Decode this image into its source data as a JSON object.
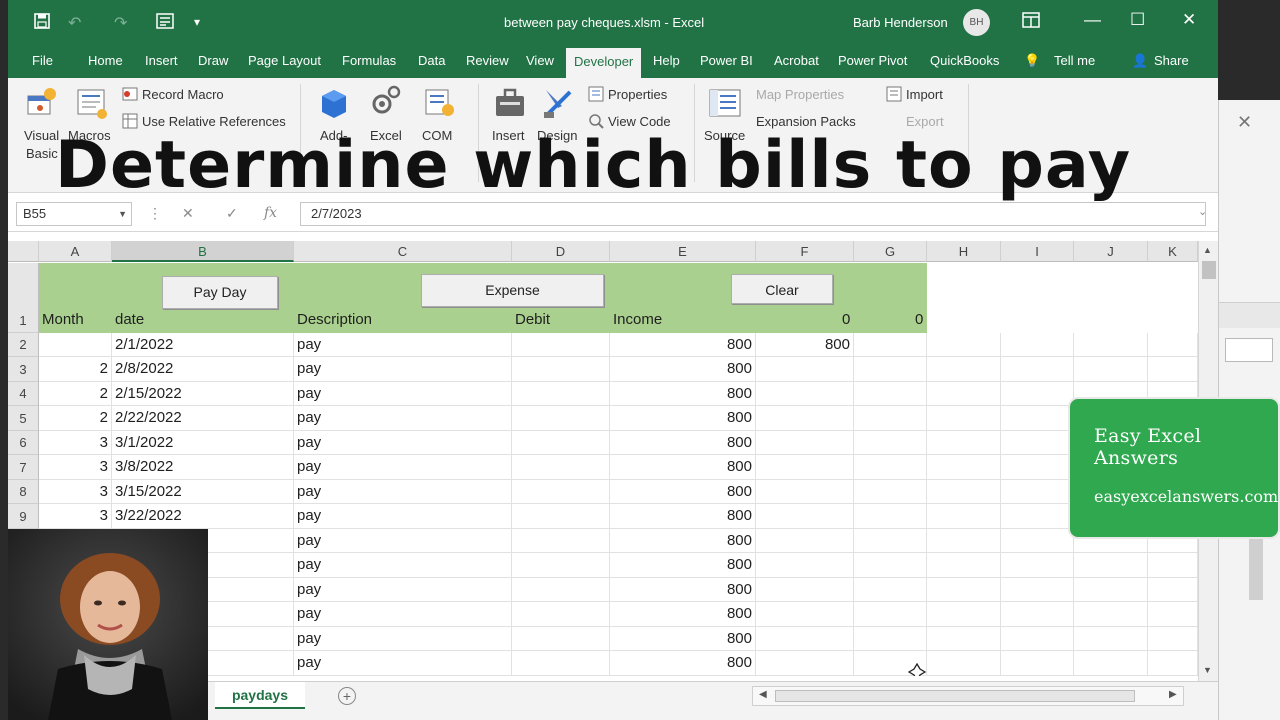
{
  "window": {
    "doc_title": "between pay cheques.xlsm - Excel",
    "user_name": "Barb Henderson",
    "user_initials": "BH"
  },
  "tabs": [
    {
      "label": "File"
    },
    {
      "label": "Home"
    },
    {
      "label": "Insert"
    },
    {
      "label": "Draw"
    },
    {
      "label": "Page Layout"
    },
    {
      "label": "Formulas"
    },
    {
      "label": "Data"
    },
    {
      "label": "Review"
    },
    {
      "label": "View"
    },
    {
      "label": "Developer",
      "active": true
    },
    {
      "label": "Help"
    },
    {
      "label": "Power BI"
    },
    {
      "label": "Acrobat"
    },
    {
      "label": "Power Pivot"
    },
    {
      "label": "QuickBooks"
    }
  ],
  "tell_me": "Tell me",
  "share": "Share",
  "ribbon": {
    "visual_basic": "Visual",
    "visual_basic_2": "Basic",
    "macros": "Macros",
    "record_macro": "Record Macro",
    "relative_refs": "Use Relative References",
    "addins": "Add-",
    "excel_addins": "Excel",
    "com_addins": "COM",
    "insert": "Insert",
    "design_mode": "Design",
    "properties": "Properties",
    "view_code": "View Code",
    "source": "Source",
    "map_properties": "Map Properties",
    "expansion_packs": "Expansion Packs",
    "import": "Import",
    "export": "Export"
  },
  "overlay_title": "Determine which bills to pay",
  "formula_bar": {
    "name_box": "B55",
    "formula": "2/7/2023"
  },
  "columns": [
    "A",
    "B",
    "C",
    "D",
    "E",
    "F",
    "G",
    "H",
    "I",
    "J",
    "K"
  ],
  "selected_column": "B",
  "buttons": {
    "pay_day": "Pay Day",
    "expense": "Expense",
    "clear": "Clear"
  },
  "header_row": {
    "row_num": "1",
    "month": "Month",
    "date": "date",
    "description": "Description",
    "debit": "Debit",
    "income": "Income",
    "f": "0",
    "g": "0"
  },
  "rows": [
    {
      "num": "2",
      "month": "",
      "date": "2/1/2022",
      "desc": "pay",
      "income": "800",
      "f": "800"
    },
    {
      "num": "3",
      "month": "2",
      "date": "2/8/2022",
      "desc": "pay",
      "income": "800",
      "f": ""
    },
    {
      "num": "4",
      "month": "2",
      "date": "2/15/2022",
      "desc": "pay",
      "income": "800",
      "f": ""
    },
    {
      "num": "5",
      "month": "2",
      "date": "2/22/2022",
      "desc": "pay",
      "income": "800",
      "f": ""
    },
    {
      "num": "6",
      "month": "3",
      "date": "3/1/2022",
      "desc": "pay",
      "income": "800",
      "f": ""
    },
    {
      "num": "7",
      "month": "3",
      "date": "3/8/2022",
      "desc": "pay",
      "income": "800",
      "f": ""
    },
    {
      "num": "8",
      "month": "3",
      "date": "3/15/2022",
      "desc": "pay",
      "income": "800",
      "f": ""
    },
    {
      "num": "9",
      "month": "3",
      "date": "3/22/2022",
      "desc": "pay",
      "income": "800",
      "f": ""
    },
    {
      "num": "",
      "month": "",
      "date": "",
      "desc": "pay",
      "income": "800",
      "f": ""
    },
    {
      "num": "",
      "month": "",
      "date": "",
      "desc": "pay",
      "income": "800",
      "f": ""
    },
    {
      "num": "",
      "month": "",
      "date": "",
      "desc": "pay",
      "income": "800",
      "f": ""
    },
    {
      "num": "",
      "month": "",
      "date": "",
      "desc": "pay",
      "income": "800",
      "f": ""
    },
    {
      "num": "",
      "month": "",
      "date": "",
      "desc": "pay",
      "income": "800",
      "f": ""
    },
    {
      "num": "",
      "month": "",
      "date": "",
      "desc": "pay",
      "income": "800",
      "f": ""
    }
  ],
  "sheet_tab": "paydays",
  "promo": {
    "line1": "Easy Excel Answers",
    "line2": "easyexcelanswers.com"
  },
  "colors": {
    "excel_green": "#217346",
    "header_band": "#a9d08e",
    "promo_green": "#2fa84f"
  }
}
